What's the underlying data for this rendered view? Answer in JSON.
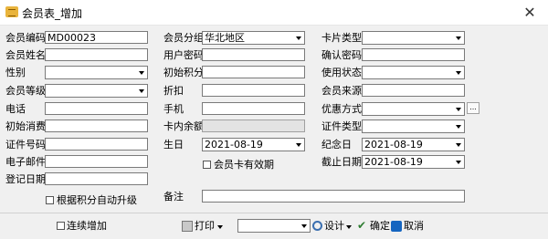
{
  "window": {
    "title": "会员表_增加",
    "close_glyph": "✕"
  },
  "fields": {
    "member_code": {
      "label": "会员编码",
      "value": "MD00023"
    },
    "member_group": {
      "label": "会员分组",
      "value": "华北地区"
    },
    "card_type": {
      "label": "卡片类型",
      "value": ""
    },
    "member_name": {
      "label": "会员姓名",
      "value": ""
    },
    "user_password": {
      "label": "用户密码",
      "value": ""
    },
    "confirm_password": {
      "label": "确认密码",
      "value": ""
    },
    "gender": {
      "label": "性别",
      "value": ""
    },
    "initial_points": {
      "label": "初始积分",
      "value": ""
    },
    "usage_status": {
      "label": "使用状态",
      "value": ""
    },
    "member_level": {
      "label": "会员等级",
      "value": ""
    },
    "discount": {
      "label": "折扣",
      "value": ""
    },
    "member_source": {
      "label": "会员来源",
      "value": ""
    },
    "phone": {
      "label": "电话",
      "value": ""
    },
    "mobile": {
      "label": "手机",
      "value": ""
    },
    "promotion_method": {
      "label": "优惠方式",
      "value": "",
      "button": "..."
    },
    "initial_spending": {
      "label": "初始消费",
      "value": ""
    },
    "card_balance": {
      "label": "卡内余额",
      "value": ""
    },
    "id_type": {
      "label": "证件类型",
      "value": ""
    },
    "id_number": {
      "label": "证件号码",
      "value": ""
    },
    "birthday": {
      "label": "生日",
      "value": "2021-08-19"
    },
    "anniversary": {
      "label": "纪念日",
      "value": "2021-08-19"
    },
    "email": {
      "label": "电子邮件",
      "value": ""
    },
    "expiry_date": {
      "label": "截止日期",
      "value": "2021-08-19"
    },
    "register_date": {
      "label": "登记日期",
      "value": ""
    },
    "remarks": {
      "label": "备注",
      "value": ""
    }
  },
  "checkboxes": {
    "card_valid": {
      "label": "会员卡有效期",
      "checked": false
    },
    "auto_upgrade": {
      "label": "根据积分自动升级",
      "checked": false
    },
    "continuous_add": {
      "label": "连续增加",
      "checked": false
    }
  },
  "toolbar": {
    "print_label": "打印",
    "print_template_value": "",
    "design_label": "设计",
    "confirm_label": "确定",
    "cancel_label": "取消"
  },
  "colors": {
    "form_bg": "#f0f0f0",
    "field_border": "#7a7a7a",
    "readonly_bg": "#e3e3e3",
    "confirm_icon": "#2e7d32",
    "cancel_icon": "#1565c0"
  }
}
